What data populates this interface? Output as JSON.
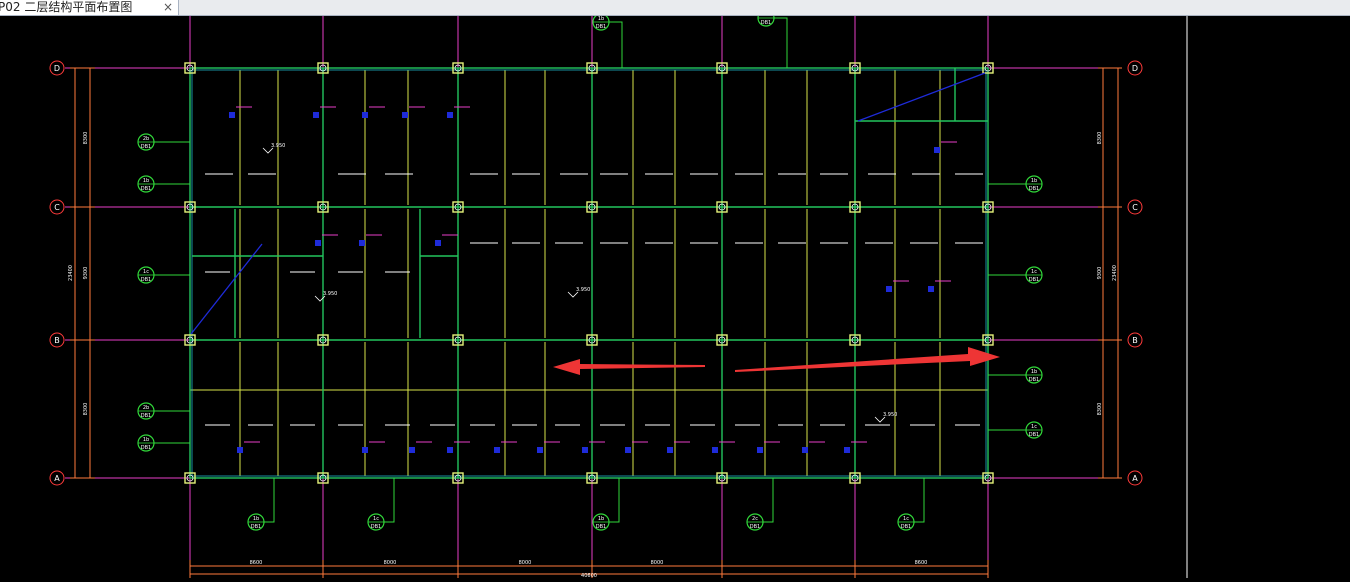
{
  "tab": {
    "title": "P02 二层结构平面布置图",
    "close_glyph": "×"
  },
  "axes": {
    "rows_left": [
      "D",
      "C",
      "B",
      "A"
    ],
    "rows_right": [
      "D",
      "C",
      "B",
      "A"
    ]
  },
  "dimensions": {
    "left_segments": [
      "8300",
      "9300",
      "8300"
    ],
    "left_total": "23400",
    "right_segments": [
      "8300",
      "9300",
      "8300"
    ],
    "right_total": "23400",
    "bottom_segments": [
      "8600",
      "8000",
      "8000",
      "8000",
      "8600"
    ],
    "bottom_total": "40600"
  },
  "tags": {
    "top": [
      {
        "num": "1b",
        "ref": "DB1"
      },
      {
        "num": "",
        "ref": "DB1"
      }
    ],
    "left": [
      {
        "num": "2b",
        "ref": "DB1"
      },
      {
        "num": "1b",
        "ref": "DB1"
      },
      {
        "num": "1c",
        "ref": "DB1"
      },
      {
        "num": "2b",
        "ref": "DB1"
      },
      {
        "num": "1b",
        "ref": "DB1"
      }
    ],
    "right": [
      {
        "num": "1b",
        "ref": "DB1"
      },
      {
        "num": "1c",
        "ref": "DB1"
      },
      {
        "num": "1b",
        "ref": "DB1"
      },
      {
        "num": "1c",
        "ref": "DB1"
      }
    ],
    "bottom": [
      {
        "num": "1b",
        "ref": "DB1"
      },
      {
        "num": "1c",
        "ref": "DB1"
      },
      {
        "num": "1b",
        "ref": "DB1"
      },
      {
        "num": "2c",
        "ref": "DB1"
      },
      {
        "num": "1c",
        "ref": "DB1"
      }
    ]
  },
  "elevations": [
    "3.950",
    "3.950",
    "3.950",
    "3.950"
  ],
  "colors": {
    "background": "#000000",
    "beam": "#22c55e",
    "column": "#e5f27a",
    "joist": "#d8e34a",
    "axis_line": "#e83ec8",
    "dimension": "#ff7a3c",
    "bubble": "#ff3b3b",
    "tag": "#31d93a",
    "text": "#ffffff",
    "arrow": "#ee3535",
    "slab_mark": "#1e2bd9"
  }
}
